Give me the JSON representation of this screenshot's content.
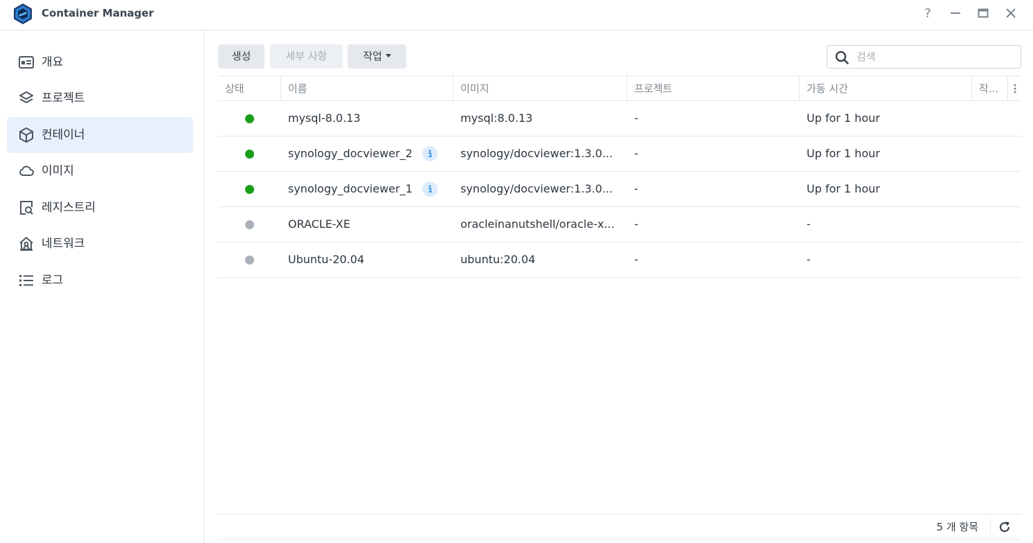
{
  "window": {
    "title": "Container Manager",
    "help_label": "?"
  },
  "sidebar": {
    "items": [
      {
        "label": "개요",
        "icon": "overview-icon",
        "active": false
      },
      {
        "label": "프로젝트",
        "icon": "layers-icon",
        "active": false
      },
      {
        "label": "컨테이너",
        "icon": "container-box-icon",
        "active": true
      },
      {
        "label": "이미지",
        "icon": "cloud-icon",
        "active": false
      },
      {
        "label": "레지스트리",
        "icon": "registry-search-icon",
        "active": false
      },
      {
        "label": "네트워크",
        "icon": "network-home-icon",
        "active": false
      },
      {
        "label": "로그",
        "icon": "list-icon",
        "active": false
      }
    ]
  },
  "toolbar": {
    "create_label": "생성",
    "details_label": "세부 사항",
    "action_label": "작업",
    "search_placeholder": "검색"
  },
  "table": {
    "columns": [
      "상태",
      "이름",
      "이미지",
      "프로젝트",
      "가동 시간",
      "작..."
    ],
    "rows": [
      {
        "status": "running",
        "name": "mysql-8.0.13",
        "info": false,
        "image": "mysql:8.0.13",
        "project": "-",
        "uptime": "Up for 1 hour"
      },
      {
        "status": "running",
        "name": "synology_docviewer_2",
        "info": true,
        "image": "synology/docviewer:1.3.0...",
        "project": "-",
        "uptime": "Up for 1 hour"
      },
      {
        "status": "running",
        "name": "synology_docviewer_1",
        "info": true,
        "image": "synology/docviewer:1.3.0...",
        "project": "-",
        "uptime": "Up for 1 hour"
      },
      {
        "status": "stopped",
        "name": "ORACLE-XE",
        "info": false,
        "image": "oracleinanutshell/oracle-x...",
        "project": "-",
        "uptime": "-"
      },
      {
        "status": "stopped",
        "name": "Ubuntu-20.04",
        "info": false,
        "image": "ubuntu:20.04",
        "project": "-",
        "uptime": "-"
      }
    ]
  },
  "footer": {
    "count_label": "5 개 항목"
  },
  "colors": {
    "running": "#1a9e1a",
    "stopped": "#a9b0b8",
    "active_nav": "#e6f1fc",
    "accent": "#1e88e5"
  }
}
